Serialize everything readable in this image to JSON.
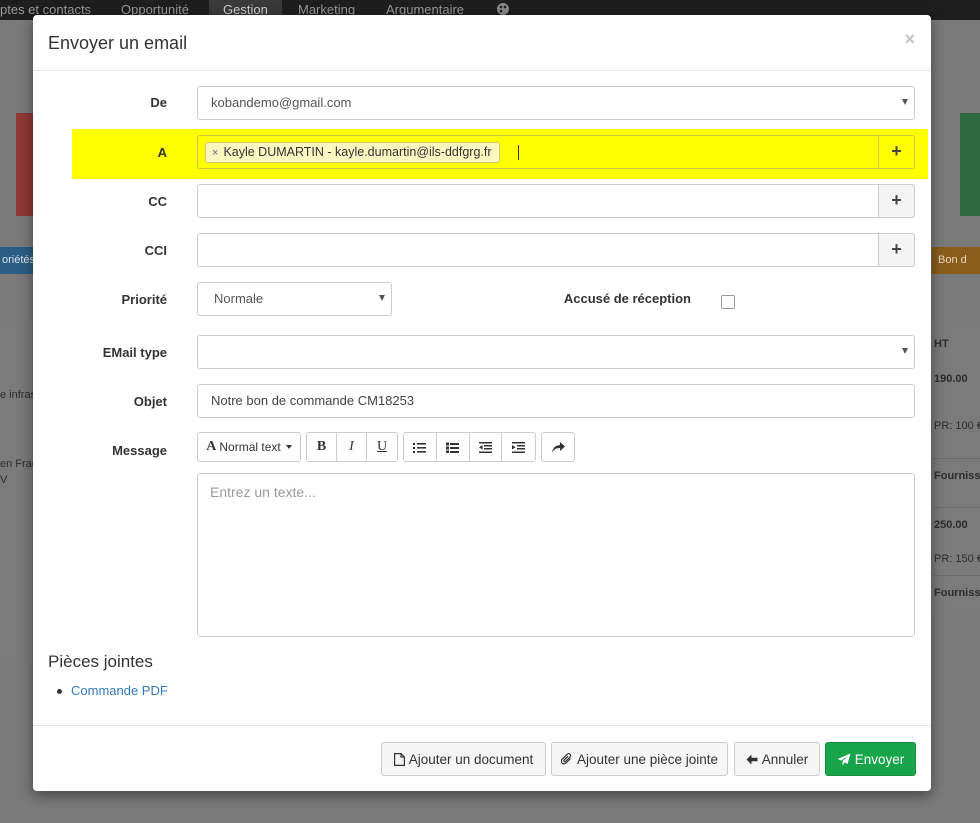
{
  "background": {
    "nav": [
      "ptes et contacts",
      "Opportunité",
      "Gestion",
      "Marketing",
      "Argumentaire"
    ],
    "active_nav": "Gestion",
    "left_texts": [
      "oriétés",
      "e infras",
      "en Fran",
      "V"
    ],
    "right_texts": [
      "Bon d",
      "HT",
      "190.00",
      "PR: 100 €",
      "Fournisse",
      "250.00",
      "PR: 150 €",
      "Fournisse"
    ]
  },
  "modal": {
    "title": "Envoyer un email",
    "close": "×",
    "from": {
      "label": "De",
      "value": "kobandemo@gmail.com"
    },
    "to": {
      "label": "A",
      "recipient": "Kayle DUMARTIN - kayle.dumartin@ils-ddfgrg.fr",
      "remove": "×"
    },
    "cc": {
      "label": "CC",
      "value": ""
    },
    "bcc": {
      "label": "CCI",
      "value": ""
    },
    "add": "+",
    "priority": {
      "label": "Priorité",
      "value": "Normale"
    },
    "receipt": {
      "label": "Accusé de réception"
    },
    "email_type": {
      "label": "EMail type",
      "value": ""
    },
    "subject": {
      "label": "Objet",
      "value": "Notre bon de commande CM18253"
    },
    "message": {
      "label": "Message",
      "placeholder": "Entrez un texte..."
    },
    "editor": {
      "font_style": "Normal text",
      "bold": "B",
      "italic": "I",
      "underline": "U"
    },
    "attachments": {
      "title": "Pièces jointes",
      "items": [
        "Commande PDF"
      ]
    },
    "footer": {
      "add_document": "Ajouter un document",
      "add_attachment": "Ajouter une pièce jointe",
      "cancel": "Annuler",
      "send": "Envoyer"
    },
    "colors": {
      "highlight": "#ffff00",
      "send": "#18a44a",
      "link": "#337ab7"
    }
  }
}
